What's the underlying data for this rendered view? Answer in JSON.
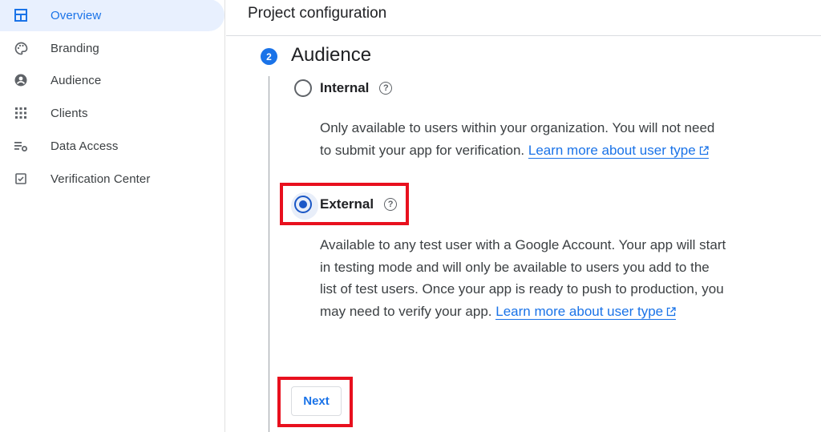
{
  "sidebar": {
    "items": [
      {
        "label": "Overview",
        "icon": "dashboard-icon",
        "active": true
      },
      {
        "label": "Branding",
        "icon": "palette-icon"
      },
      {
        "label": "Audience",
        "icon": "account-circle-icon"
      },
      {
        "label": "Clients",
        "icon": "apps-grid-icon"
      },
      {
        "label": "Data Access",
        "icon": "data-settings-icon"
      },
      {
        "label": "Verification Center",
        "icon": "checkbox-icon"
      }
    ]
  },
  "header": {
    "title": "Project configuration"
  },
  "step": {
    "number": "2",
    "title": "Audience"
  },
  "options": {
    "internal": {
      "label": "Internal",
      "selected": false,
      "description": "Only available to users within your organization. You will not need to submit your app for verification.",
      "link": "Learn more about user type"
    },
    "external": {
      "label": "External",
      "selected": true,
      "description": "Available to any test user with a Google Account. Your app will start in testing mode and will only be available to users you add to the list of test users. Once your app is ready to push to production, you may need to verify your app.",
      "link": "Learn more about user type"
    }
  },
  "actions": {
    "next_label": "Next"
  },
  "colors": {
    "accent": "#1a73e8",
    "highlight": "#e8101e",
    "active_bg": "#e8f0fe"
  }
}
